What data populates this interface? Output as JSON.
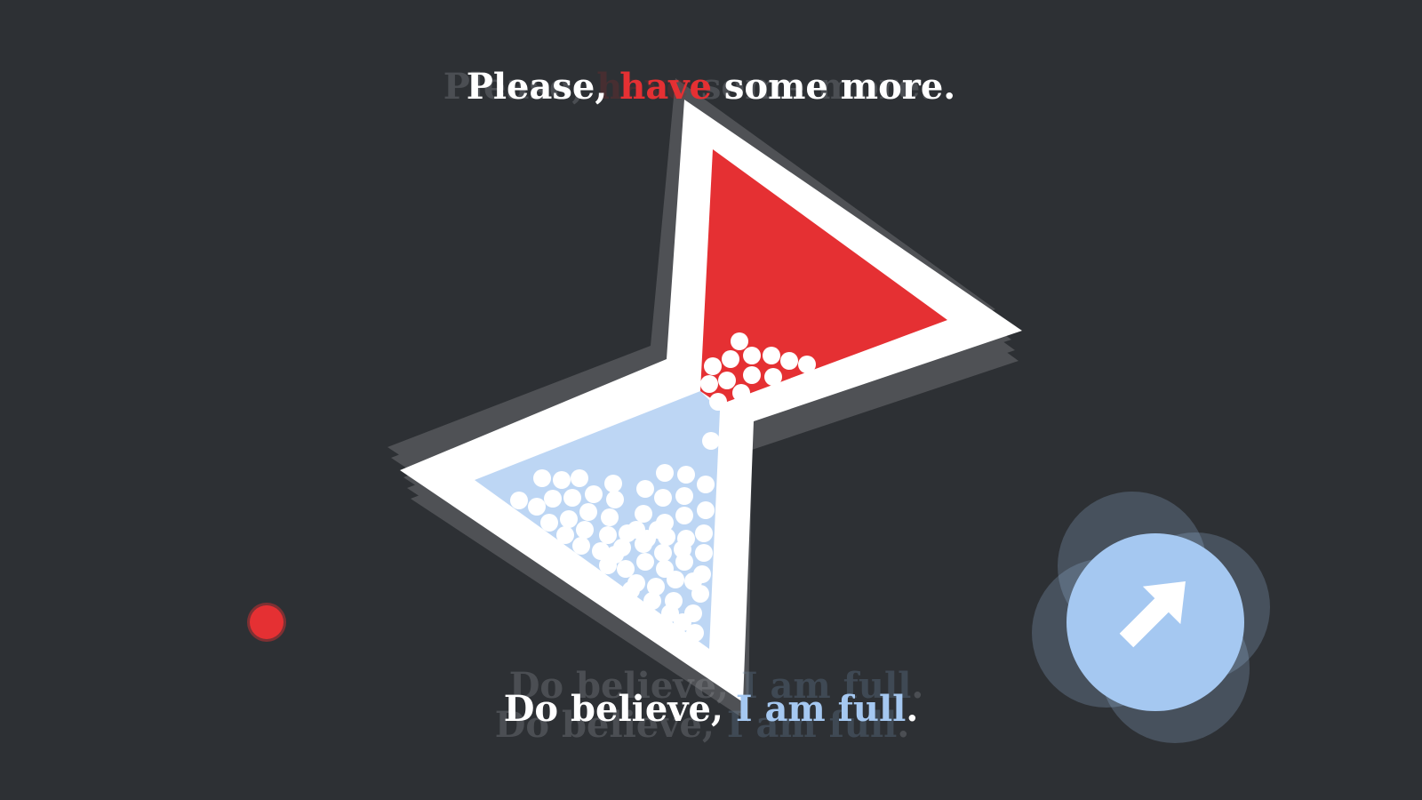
{
  "top_caption": {
    "part1": "Please,",
    "part2": "have",
    "part3": "some more."
  },
  "bottom_caption": {
    "part1": "Do believe,",
    "part2": "I am full",
    "part3": "."
  },
  "colors": {
    "background": "#2d3034",
    "frame": "#ffffff",
    "top_chamber": "#e53033",
    "bottom_chamber": "#bdd6f4",
    "ball": "#ffffff",
    "indicator_dot": "#e53033",
    "action_button": "#a5c8f1"
  },
  "action_button": {
    "icon": "arrow-up-right-icon"
  }
}
